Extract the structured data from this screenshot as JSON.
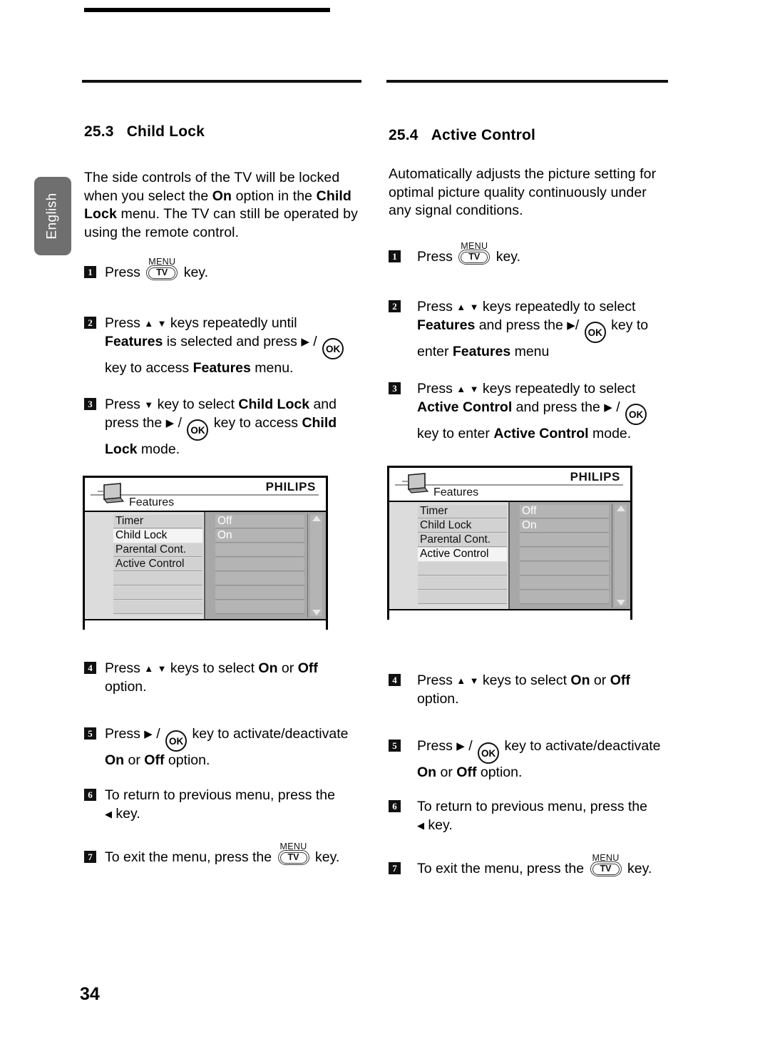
{
  "page": {
    "number": "34",
    "language_tab": "English"
  },
  "left_column": {
    "section": {
      "number": "25.3",
      "title": "Child Lock"
    },
    "intro": [
      {
        "t": "The side controls of the TV will be locked"
      },
      {
        "t": "when you select the "
      },
      {
        "b": "On"
      },
      {
        "t": " option in the "
      },
      {
        "b": "Child"
      },
      {
        "t": "Lock"
      },
      {
        "t": " menu. The TV can still be operated by"
      },
      {
        "t": "using the remote control."
      }
    ],
    "intro_text": "The side controls of the TV will be locked when you select the On option in the Child Lock menu. The TV can still be operated by using the remote control.",
    "steps": [
      {
        "n": "1",
        "text": "Press  [MENU/TV]  key."
      },
      {
        "n": "2",
        "text": "Press  ▲ ▼ keys repeatedly until Features is selected and press  ▶ / OK key to access Features menu."
      },
      {
        "n": "3",
        "text": "Press  ▼ key to select Child Lock and press the  ▶ / OK key to access Child Lock mode."
      },
      {
        "n": "4",
        "text": "Press ▲ ▼ keys to select On or Off option."
      },
      {
        "n": "5",
        "text": "Press ▶ / OK key to activate/deactivate On or Off option."
      },
      {
        "n": "6",
        "text": "To return to previous menu, press the ◀ key."
      },
      {
        "n": "7",
        "text": "To exit the menu, press the [MENU/TV] key."
      }
    ],
    "osd": {
      "title": "Features",
      "brand": "PHILIPS",
      "menu_items": [
        "Timer",
        "Child Lock",
        "Parental Cont.",
        "Active Control"
      ],
      "selected_item": "Child Lock",
      "options": [
        "Off",
        "On"
      ],
      "icon": "tv-icon",
      "scroll_up": "scroll-up-arrow",
      "scroll_down": "scroll-down-arrow"
    }
  },
  "right_column": {
    "section": {
      "number": "25.4",
      "title": "Active Control"
    },
    "intro_text": "Automatically adjusts the picture setting for optimal picture quality continuously under any signal conditions.",
    "steps": [
      {
        "n": "1",
        "text": "Press  [MENU/TV]  key."
      },
      {
        "n": "2",
        "text": "Press ▲ ▼ keys repeatedly to select Features and press the  ▶/ OK key to enter Features menu"
      },
      {
        "n": "3",
        "text": "Press  ▲ ▼ keys repeatedly to select Active Control and press the ▶ / OK key to enter Active Control mode."
      },
      {
        "n": "4",
        "text": "Press ▲ ▼ keys to select On or Off option."
      },
      {
        "n": "5",
        "text": "Press ▶ / OK key to activate/deactivate On or Off option."
      },
      {
        "n": "6",
        "text": "To return to previous menu, press the ◀ key."
      },
      {
        "n": "7",
        "text": "To exit the menu, press the [MENU/TV] key."
      }
    ],
    "osd": {
      "title": "Features",
      "brand": "PHILIPS",
      "menu_items": [
        "Timer",
        "Child Lock",
        "Parental Cont.",
        "Active Control"
      ],
      "selected_item": "Active Control",
      "options": [
        "Off",
        "On"
      ],
      "icon": "tv-icon",
      "scroll_up": "scroll-up-arrow",
      "scroll_down": "scroll-down-arrow"
    }
  },
  "keys": {
    "menu_label": "MENU",
    "tv_label": "TV",
    "ok_label": "OK"
  },
  "fragments": {
    "l_intro_1": "The side controls of the TV will be locked",
    "l_intro_2a": "when you select the ",
    "l_intro_2b": "On",
    "l_intro_2c": " option in the ",
    "l_intro_2d": "Child",
    "l_intro_3a": "Lock",
    "l_intro_3b": " menu. The TV can still be operated by",
    "l_intro_4": "using the remote control.",
    "r_intro_1": "Automatically adjusts the picture setting for",
    "r_intro_2": "optimal picture quality continuously under",
    "r_intro_3": "any signal conditions.",
    "press": "Press",
    "press_sp": "Press ",
    "key_word": "key.",
    "l2a": "keys repeatedly until",
    "l2b": "Features",
    "l2c": " is selected and press ",
    "l2d": "key to access ",
    "l2e": "Features",
    "l2f": " menu.",
    "l3a": "key to select ",
    "l3b": "Child Lock",
    "l3c": " and",
    "l3d": "press the ",
    "l3e": "key to access ",
    "l3f": "Child",
    "l3g": "Lock",
    "l3h": " mode.",
    "s4a": "keys to select ",
    "s4b": "On",
    "s4c": " or ",
    "s4d": "Off",
    "s4e": "option.",
    "s5a": "key to activate/deactivate",
    "s5b": "On",
    "s5c": " or ",
    "s5d": "Off",
    "s5e": " option.",
    "s6a": "To return to previous menu, press the",
    "s6b": "key.",
    "s7a": "To exit the menu, press the",
    "s7b": "key.",
    "r2a": "keys repeatedly to select",
    "r2b": "Features",
    "r2c": " and press the ",
    "r2d": "key to",
    "r2e": "enter ",
    "r2f": "Features",
    "r2g": " menu",
    "r3a": "keys repeatedly to select",
    "r3b": "Active Control",
    "r3c": " and press the ",
    "r3d": "key to enter ",
    "r3e": "Active Control",
    "r3f": " mode."
  }
}
